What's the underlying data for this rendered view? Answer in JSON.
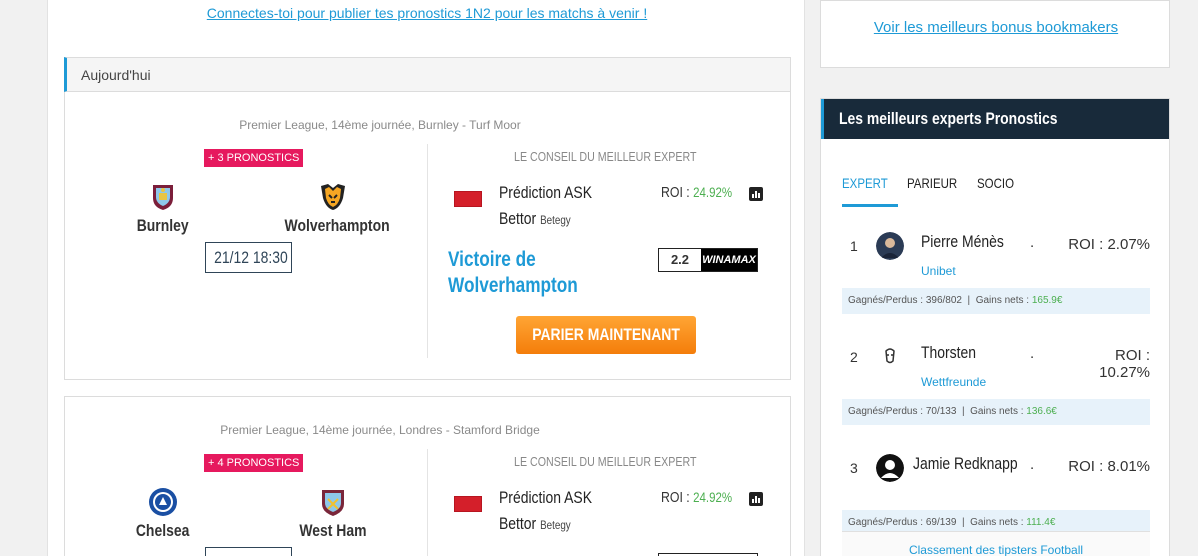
{
  "main": {
    "connect_link": "Connectes-toi pour publier tes pronostics 1N2 pour les matchs à venir !",
    "section_title": "Aujourd'hui",
    "expert_label": "LE CONSEIL DU MEILLEUR EXPERT",
    "bet_button": "PARIER MAINTENANT",
    "matches": [
      {
        "league": "Premier League, 14ème journée,  Burnley - Turf Moor",
        "badge": "+ 3 PRONOSTICS",
        "home": "Burnley",
        "away": "Wolverhampton",
        "date": "21/12 18:30",
        "predictor": "Prédiction ASK",
        "predictor_line2": "Bettor",
        "predictor_site": "Betegy",
        "roi_label": "ROI : ",
        "roi_value": "24.92%",
        "pick": "Victoire de Wolverhampton",
        "odd": "2.2",
        "bookmaker": "WINAMAX"
      },
      {
        "league": "Premier League, 14ème journée,  Londres - Stamford Bridge",
        "badge": "+ 4 PRONOSTICS",
        "home": "Chelsea",
        "away": "West Ham",
        "predictor": "Prédiction ASK",
        "predictor_line2": "Bettor",
        "predictor_site": "Betegy",
        "roi_label": "ROI : ",
        "roi_value": "24.92%"
      }
    ]
  },
  "sidebar": {
    "bonus_link": "Voir les meilleurs bonus bookmakers",
    "experts_title": "Les meilleurs experts Pronostics",
    "tabs": [
      "EXPERT",
      "PARIEUR",
      "SOCIO"
    ],
    "experts": [
      {
        "rank": "1",
        "name": "Pierre Ménès",
        "roi": "ROI : 2.07%",
        "book": "Unibet",
        "gp_label": "Gagnés/Perdus : ",
        "gp": "396/802",
        "gains_label": "Gains nets : ",
        "gains": "165.9€"
      },
      {
        "rank": "2",
        "name": "Thorsten",
        "roi": "ROI : 10.27%",
        "book": "Wettfreunde",
        "gp_label": "Gagnés/Perdus : ",
        "gp": "70/133",
        "gains_label": "Gains nets : ",
        "gains": "136.6€"
      },
      {
        "rank": "3",
        "name": "Jamie Redknapp",
        "roi": "ROI : 8.01%",
        "book": "",
        "gp_label": "Gagnés/Perdus : ",
        "gp": "69/139",
        "gains_label": "Gains nets : ",
        "gains": "111.4€"
      }
    ],
    "footer_link": "Classement des tipsters Football"
  },
  "colors": {
    "accent": "#1e9ad6",
    "badge": "#e6195e",
    "button": "#f47d0a",
    "header_dark": "#182a3a",
    "positive": "#4caf50"
  }
}
